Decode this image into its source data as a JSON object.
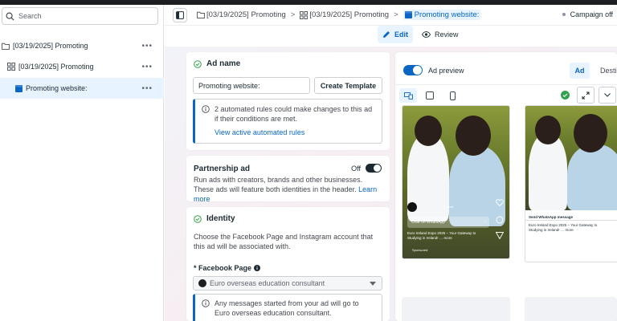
{
  "sidebar": {
    "search_placeholder": "Search",
    "items": [
      {
        "label": "[03/19/2025] Promoting"
      },
      {
        "label": "[03/19/2025] Promoting"
      },
      {
        "label": "Promoting website:"
      }
    ],
    "more": "•••"
  },
  "breadcrumb": {
    "items": [
      {
        "label": "[03/19/2025] Promoting"
      },
      {
        "label": "[03/19/2025] Promoting"
      },
      {
        "label": "Promoting website:"
      }
    ],
    "separator": ">"
  },
  "campaign_status": "Campaign off",
  "mode": {
    "edit_label": "Edit",
    "review_label": "Review"
  },
  "ad_name": {
    "title": "Ad name",
    "value": "Promoting website:",
    "create_template": "Create Template",
    "notice": "2 automated rules could make changes to this ad if their conditions are met.",
    "link": "View active automated rules"
  },
  "partnership": {
    "title": "Partnership ad",
    "toggle_label": "Off",
    "description": "Run ads with creators, brands and other businesses. These ads will feature both identities in the header.",
    "learn_more": "Learn more"
  },
  "identity": {
    "title": "Identity",
    "description": "Choose the Facebook Page and Instagram account that this ad will be associated with.",
    "page_label": "* Facebook Page",
    "page_value": "Euro overseas education consultant",
    "notice": "Any messages started from your ad will go to Euro overseas education consultant."
  },
  "preview": {
    "toggle_label": "Ad preview",
    "tabs": [
      {
        "label": "Ad"
      },
      {
        "label": "Destin"
      }
    ],
    "story_cta": "Chat on WhatsApp",
    "story_caption": "Euro Ireland Expo 2025 – Your Gateway to Studying in Ireland! … more",
    "story_sponsored": "Sponsored",
    "story_follow": "Follow",
    "feed_cta": "Send WhatsApp message",
    "feed_caption": "Euro Ireland Expo 2025 – Your Gateway to Studying in Ireland! … more"
  },
  "colors": {
    "accent": "#0a66c2",
    "accent_bg": "#e7f3ff",
    "status_active": "#31a24c"
  }
}
